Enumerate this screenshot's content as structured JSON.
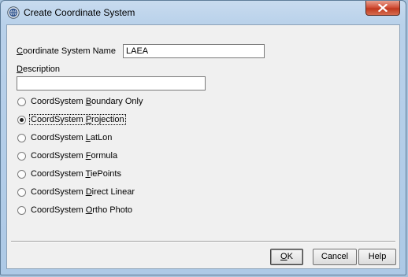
{
  "window": {
    "title": "Create Coordinate System"
  },
  "form": {
    "name_label_prefix": "C",
    "name_label_rest": "oordinate System Name",
    "name_value": "LAEA",
    "description_label_prefix": "D",
    "description_label_rest": "escription",
    "description_value": ""
  },
  "options": [
    {
      "pre": "CoordSystem ",
      "key": "B",
      "post": "oundary Only",
      "checked": false
    },
    {
      "pre": "CoordSystem ",
      "key": "P",
      "post": "rojection",
      "checked": true
    },
    {
      "pre": "CoordSystem ",
      "key": "L",
      "post": "atLon",
      "checked": false
    },
    {
      "pre": "CoordSystem ",
      "key": "F",
      "post": "ormula",
      "checked": false
    },
    {
      "pre": "CoordSystem ",
      "key": "T",
      "post": "iePoints",
      "checked": false
    },
    {
      "pre": "CoordSystem ",
      "key": "D",
      "post": "irect Linear",
      "checked": false
    },
    {
      "pre": "CoordSystem ",
      "key": "O",
      "post": "rtho Photo",
      "checked": false
    }
  ],
  "buttons": {
    "ok_key": "O",
    "ok_rest": "K",
    "cancel": "Cancel",
    "help": "Help"
  },
  "icons": {
    "app": "globe-icon",
    "close": "close-icon"
  },
  "colors": {
    "close_button": "#c0391f",
    "titlebar": "#b9d1ea"
  }
}
